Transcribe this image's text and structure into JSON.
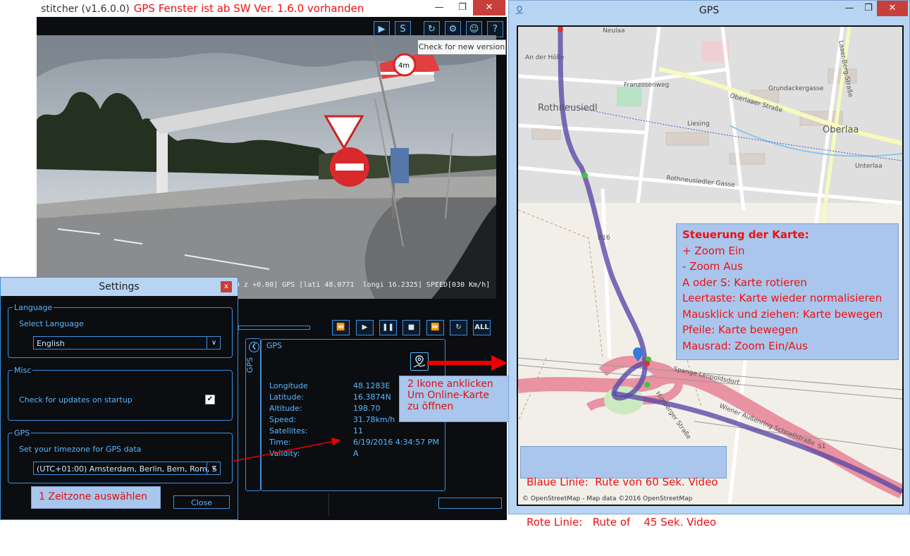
{
  "stitcher": {
    "title": "stitcher (v1.6.0.0)",
    "title_note": "GPS Fenster ist ab SW Ver. 1.6.0 vorhanden",
    "window_controls": {
      "minimize": "—",
      "maximize": "❐",
      "close": "✕"
    },
    "toolbar_icons": [
      "play-circle-icon",
      "stitch-s-icon",
      "update-icon",
      "gear-icon",
      "user-icon",
      "help-icon"
    ],
    "toolbar_glyphs": [
      "▶",
      "S",
      "↻",
      "⚙",
      "☺",
      "?"
    ],
    "tooltip": "Check for new version",
    "video_osd": "9 z +0.00] GPS [lati 48.0771  longi 16.2325] SPEED[030 Km/h]",
    "playback": [
      "⏪",
      "▶",
      "❚❚",
      "■",
      "⏩",
      "↻",
      "ALL"
    ],
    "gps_side_label": "GPS",
    "gps_side_arrow": "❮",
    "gps_panel": {
      "title": "GPS",
      "rows": [
        {
          "label": "Longitude",
          "value": "48.1283E"
        },
        {
          "label": "Latitude:",
          "value": "16.3874N"
        },
        {
          "label": "Altitude:",
          "value": "198.70"
        },
        {
          "label": "Speed:",
          "value": "31.78km/h"
        },
        {
          "label": "Satellites:",
          "value": "11"
        },
        {
          "label": "Time:",
          "value": "6/19/2016 4:34:57 PM"
        },
        {
          "label": "Validity:",
          "value": "A"
        }
      ]
    }
  },
  "settings": {
    "title": "Settings",
    "close_x": "x",
    "language": {
      "group": "Language",
      "label": "Select Language",
      "value": "English"
    },
    "misc": {
      "group": "Misc",
      "label": "Check for updates on startup",
      "checked": "✔"
    },
    "gps": {
      "group": "GPS",
      "label": "Set your timezone for GPS data",
      "value": "(UTC+01:00) Amsterdam, Berlin, Bern, Rom, S"
    },
    "select_arrow": "∨",
    "close_button": "Close"
  },
  "annotations": {
    "step1": "1 Zeitzone auswählen",
    "step2_lines": [
      "2 Ikone anklicken",
      "Um Online-Karte",
      "zu öffnen"
    ]
  },
  "gps_window": {
    "title": "GPS",
    "controls": {
      "minimize": "—",
      "maximize": "❐",
      "close": "✕"
    },
    "map_info_title": "Steuerung der Karte:",
    "map_info_lines": [
      "+ Zoom Ein",
      "- Zoom Aus",
      "A oder S: Karte rotieren",
      "Leertaste: Karte  wieder normalisieren",
      "Mausklick und ziehen:  Karte bewegen",
      "Pfeile: Karte bewegen",
      "Mausrad: Zoom Ein/Aus"
    ],
    "legend_lines": [
      "Blaue Linie:  Rute von 60 Sek. Video",
      "Rote Linie:   Rute of    45 Sek. Video"
    ],
    "attribution": "© OpenStreetMap - Map data ©2016 OpenStreetMap",
    "map_labels": {
      "rothneusiedl": "Rothneusiedl",
      "oberlaa": "Oberlaa",
      "oberlaaer": "Oberlaaer Straße",
      "laaer_berg": "Laaer-Berg-Straße",
      "grundacker": "Grundackergasse",
      "neulaa": "Neulaa",
      "an_der_hoelle": "An der Hölle",
      "franzosenweg": "Franzosenweg",
      "rothneusiedler_gasse": "Rothneusiedler Gasse",
      "himberger": "Himberger Straße",
      "wiener_aussenring": "Wiener Außenring Schnellstraße",
      "liesing": "Liesing",
      "spange": "Spange Leopoldsdorf",
      "oberlaa_road": "Unterlaa",
      "b16": "B16",
      "s1": "S1"
    }
  }
}
